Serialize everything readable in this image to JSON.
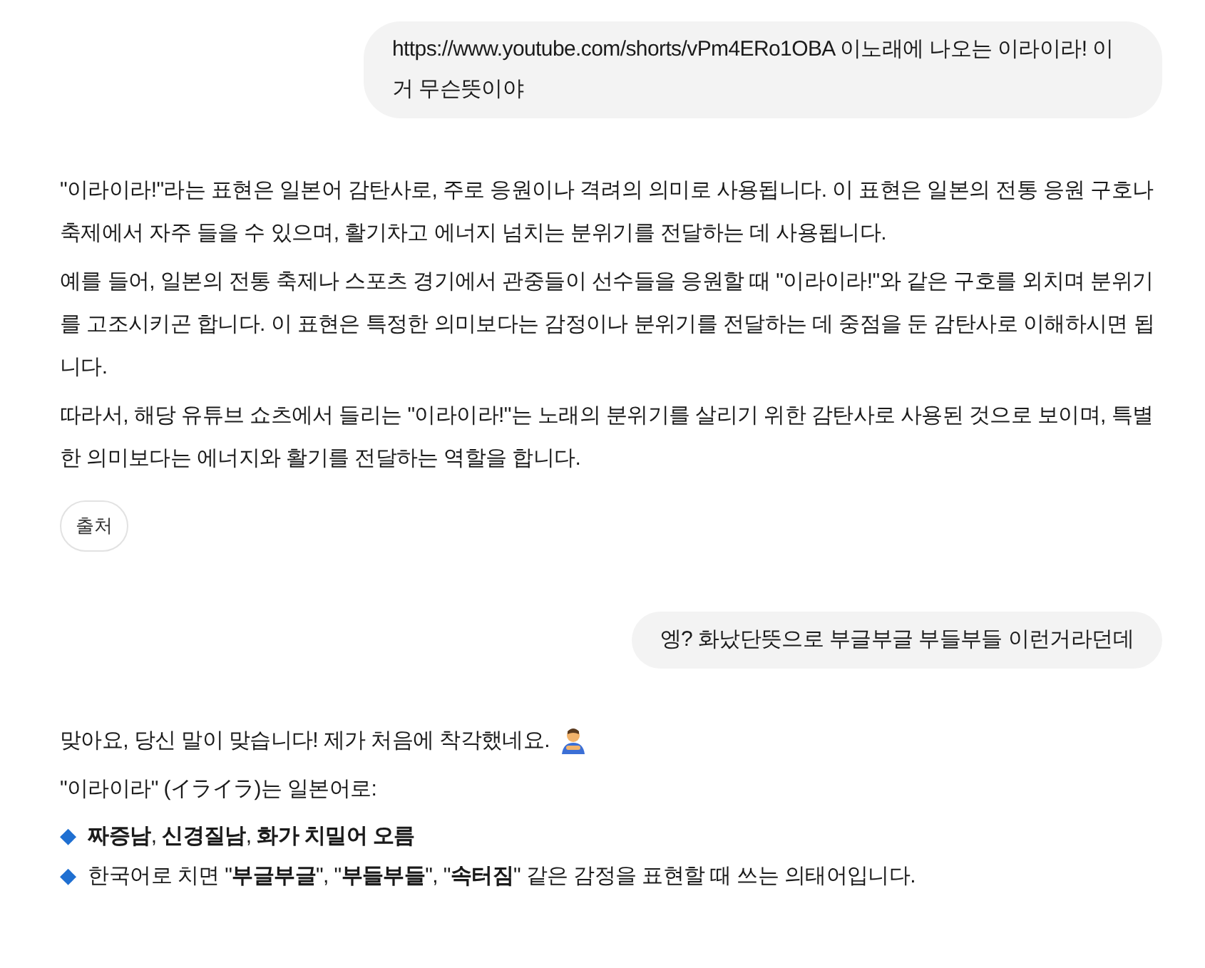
{
  "messages": [
    {
      "kind": "question",
      "text": "https://www.youtube.com/shorts/vPm4ERo1OBA 이노래에 나오는 이라이라! 이거 무슨뜻이야"
    },
    {
      "kind": "answer",
      "paragraphs": [
        {
          "text": "\"이라이라!\"라는 표현은 일본어 감탄사로, 주로 응원이나 격려의 의미로 사용됩니다. 이 표현은 일본의 전통 응원 구호나 축제에서 자주 들을 수 있으며, 활기차고 에너지 넘치는 분위기를 전달하는 데 사용됩니다."
        },
        {
          "text": "예를 들어, 일본의 전통 축제나 스포츠 경기에서 관중들이 선수들을 응원할 때 \"이라이라!\"와 같은 구호를 외치며 분위기를 고조시키곤 합니다. 이 표현은 특정한 의미보다는 감정이나 분위기를 전달하는 데 중점을 둔 감탄사로 이해하시면 됩니다."
        },
        {
          "text": "따라서, 해당 유튜브 쇼츠에서 들리는 \"이라이라!\"는 노래의 분위기를 살리기 위한 감탄사로 사용된 것으로 보이며, 특별한 의미보다는 에너지와 활기를 전달하는 역할을 합니다."
        }
      ],
      "source_button": "출처"
    },
    {
      "kind": "question",
      "text": "엥? 화났단뜻으로 부글부글 부들부들 이런거라던데"
    },
    {
      "kind": "answer",
      "paragraphs": [
        {
          "text": "맞아요, 당신 말이 맞습니다! 제가 처음에 착각했네요.",
          "emoji": true
        },
        {
          "text": "\"이라이라\" (イライラ)는 일본어로:"
        },
        {
          "kind": "bullets",
          "items": [
            {
              "bullet": "◆",
              "text": "**짜증남**, **신경질남**, **화가 치밀어 오름**"
            },
            {
              "bullet": "◆",
              "text": "한국어로 치면 \"**부글부글**\", \"**부들부들**\", \"**속터짐**\" 같은 감정을 표현할 때 쓰는 의태어입니다."
            }
          ]
        }
      ]
    }
  ]
}
